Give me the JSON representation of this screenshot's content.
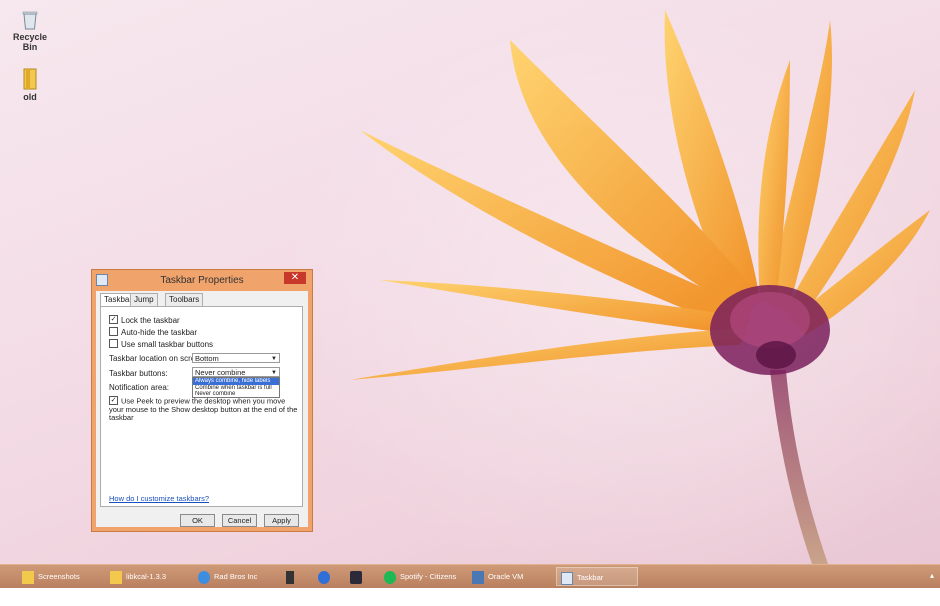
{
  "desktop": {
    "icons": [
      {
        "label": "Recycle Bin",
        "icon": "recycle-bin-icon"
      },
      {
        "label": "old",
        "icon": "folder-icon"
      }
    ]
  },
  "window": {
    "title": "Taskbar Properties",
    "close": "✕",
    "tabs": [
      "Taskbar",
      "Jump Lists",
      "Toolbars"
    ],
    "lock_taskbar": {
      "label": "Lock the taskbar",
      "checked": true
    },
    "auto_hide": {
      "label": "Auto-hide the taskbar",
      "checked": false
    },
    "small_buttons": {
      "label": "Use small taskbar buttons",
      "checked": false
    },
    "location_label": "Taskbar location on screen:",
    "location_value": "Bottom",
    "buttons_label": "Taskbar buttons:",
    "buttons_value": "Never combine",
    "buttons_options": [
      "Always combine, hide labels",
      "Combine when taskbar is full",
      "Never combine"
    ],
    "notification_label": "Notification area:",
    "peek": {
      "label": "Use Peek to preview the desktop when you move your mouse to the Show desktop button at the end of the taskbar",
      "checked": true
    },
    "help_link": "How do I customize taskbars?",
    "ok": "OK",
    "cancel": "Cancel",
    "apply": "Apply"
  },
  "taskbar": {
    "items": [
      {
        "label": "Screenshots",
        "icon": "folder-icon"
      },
      {
        "label": "libkcal-1.3.3",
        "icon": "folder-icon"
      },
      {
        "label": "Rad Bros Inc Table...",
        "icon": "internet-explorer-icon"
      },
      {
        "label": "",
        "icon": "phone-icon"
      },
      {
        "label": "",
        "icon": "chrome-icon"
      },
      {
        "label": "",
        "icon": "steam-icon"
      },
      {
        "label": "Spotify - Citizens ...",
        "icon": "spotify-icon"
      },
      {
        "label": "Oracle VM Virtual...",
        "icon": "virtualbox-icon"
      },
      {
        "label": "Taskbar Properties",
        "icon": "taskbar-properties-icon"
      }
    ]
  },
  "colors": {
    "window_frame": "#f1a36c",
    "taskbar": "#c48d6b",
    "petal": "#f5a623",
    "flower_center": "#7a1e5c",
    "selection": "#3a6fd6"
  }
}
